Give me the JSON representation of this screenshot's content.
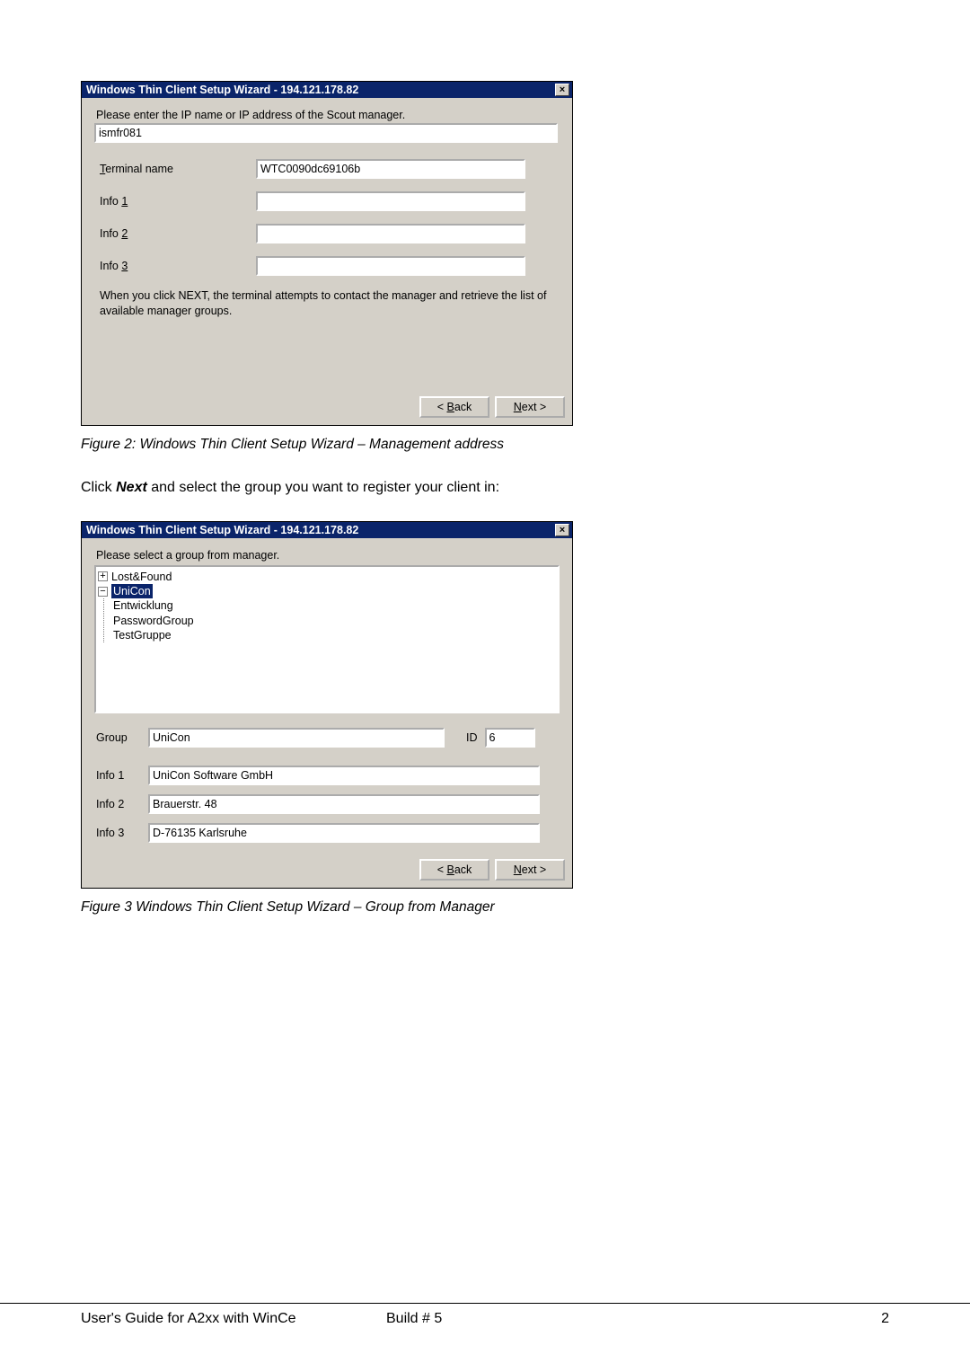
{
  "dialog1": {
    "title": "Windows Thin Client Setup Wizard - 194.121.178.82",
    "close": "×",
    "prompt": "Please enter the IP name or IP address of the Scout manager.",
    "ip_value": "ismfr081",
    "labels": {
      "terminal_pre": "T",
      "terminal_rest": "erminal name",
      "info1_pre": "Info ",
      "info1_u": "1",
      "info2_pre": "Info ",
      "info2_u": "2",
      "info3_pre": "Info ",
      "info3_u": "3"
    },
    "terminal_value": "WTC0090dc69106b",
    "info1_value": "",
    "info2_value": "",
    "info3_value": "",
    "note": "When you click NEXT, the terminal attempts to contact the manager and retrieve the list of available manager groups.",
    "back_pre": "< ",
    "back_u": "B",
    "back_rest": "ack",
    "next_u": "N",
    "next_rest": "ext >"
  },
  "caption1": "Figure 2: Windows Thin Client Setup Wizard – Management address",
  "instruction_pre": "Click ",
  "instruction_bold": "Next",
  "instruction_post": " and select the group you want to register your client in:",
  "dialog2": {
    "title": "Windows Thin Client Setup Wizard - 194.121.178.82",
    "close": "×",
    "prompt": "Please select a group from manager.",
    "tree": {
      "lostfound": "Lost&Found",
      "unicon": "UniCon",
      "entwicklung": "Entwicklung",
      "passwordgroup": "PasswordGroup",
      "testgruppe": "TestGruppe"
    },
    "group_label": "Group",
    "group_value": "UniCon",
    "id_label": "ID",
    "id_value": "6",
    "info1_label": "Info 1",
    "info1_value": "UniCon Software GmbH",
    "info2_label": "Info 2",
    "info2_value": "Brauerstr. 48",
    "info3_label": "Info 3",
    "info3_value": "D-76135 Karlsruhe",
    "back_pre": "< ",
    "back_u": "B",
    "back_rest": "ack",
    "next_u": "N",
    "next_rest": "ext >"
  },
  "caption2": "Figure 3 Windows Thin Client Setup Wizard – Group from Manager",
  "footer": {
    "left": "User's Guide for A2xx with WinCe",
    "mid": "Build # 5",
    "right": "2"
  }
}
